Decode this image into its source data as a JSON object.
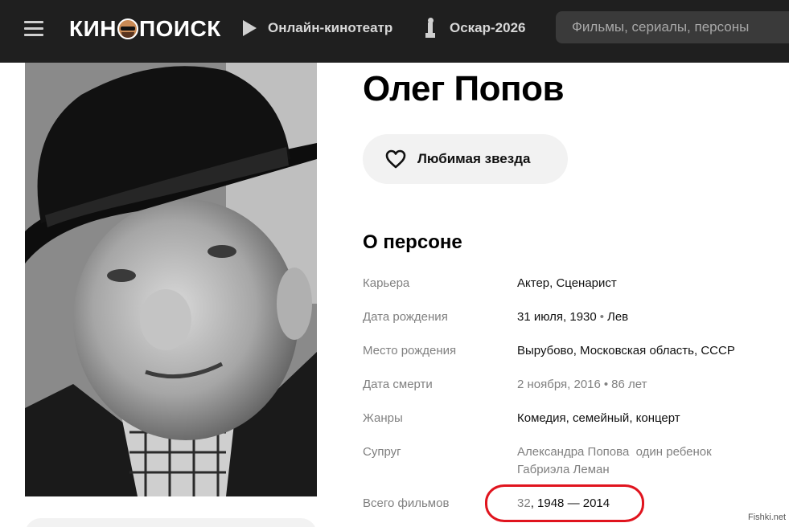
{
  "header": {
    "logo_left": "КИН",
    "logo_right": "ПОИСК",
    "nav": [
      {
        "label": "Онлайн-кинотеатр",
        "icon": "play-icon"
      },
      {
        "label": "Оскар-2026",
        "icon": "oscar-statuette-icon"
      }
    ],
    "search_placeholder": "Фильмы, сериалы, персоны"
  },
  "person": {
    "name": "Олег Попов",
    "favorite_button": "Любимая звезда",
    "section_title": "О персоне",
    "info": [
      {
        "key": "Карьера",
        "value": "Актер, Сценарист"
      },
      {
        "key": "Дата рождения",
        "value": "31 июля, 1930",
        "extra": "Лев"
      },
      {
        "key": "Место рождения",
        "value": "Вырубово, Московская область, СССР"
      },
      {
        "key": "Дата смерти",
        "value": "2 ноября, 2016",
        "extra": "86 лет"
      },
      {
        "key": "Жанры",
        "value": "Комедия, семейный, концерт"
      },
      {
        "key": "Супруг",
        "value": "Александра Попова",
        "value_note": "один ребенок",
        "value2": "Габриэла Леман"
      },
      {
        "key": "Всего фильмов",
        "count": "32",
        "years": "1948 — 2014"
      }
    ]
  },
  "watermark": "Fishki.net",
  "colors": {
    "header_bg": "#1f1f1f",
    "highlight": "#e0141e",
    "button_bg": "#f2f2f2"
  }
}
